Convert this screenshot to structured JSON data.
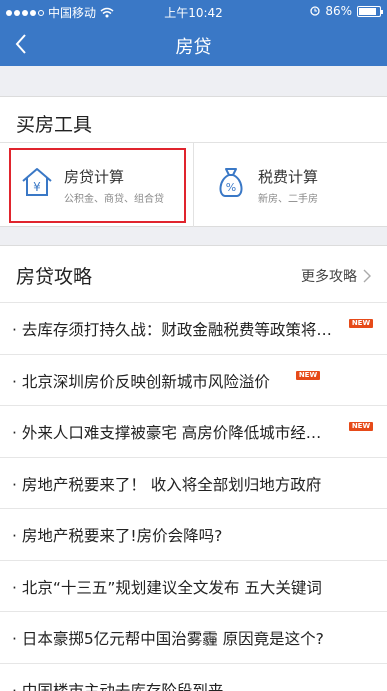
{
  "status_bar": {
    "carrier": "中国移动",
    "time": "上午10:42",
    "battery_text": "86%",
    "battery_level": 0.86,
    "icons": [
      "signal-dots",
      "wifi-icon",
      "alarm-icon",
      "battery-icon"
    ]
  },
  "nav": {
    "title": "房贷",
    "back_icon": "chevron-left-icon"
  },
  "tools": {
    "title": "买房工具",
    "items": [
      {
        "name": "房贷计算",
        "sub": "公积金、商贷、组合贷",
        "icon": "house-yen-icon",
        "highlighted": true
      },
      {
        "name": "税费计算",
        "sub": "新房、二手房",
        "icon": "money-bag-percent-icon",
        "highlighted": false
      }
    ]
  },
  "strategy": {
    "title": "房贷攻略",
    "more_label": "更多攻略",
    "badge_text": "NEW",
    "articles": [
      {
        "title": "· 去库存须打持久战：财政金融税费等政策将…",
        "is_new": true
      },
      {
        "title": "· 北京深圳房价反映创新城市风险溢价",
        "is_new": true
      },
      {
        "title": "· 外来人口难支撑被豪宅 高房价降低城市经…",
        "is_new": true
      },
      {
        "title": "· 房地产税要来了！ 收入将全部划归地方政府",
        "is_new": false
      },
      {
        "title": "· 房地产税要来了!房价会降吗?",
        "is_new": false
      },
      {
        "title": "· 北京“十三五”规划建议全文发布 五大关键词",
        "is_new": false
      },
      {
        "title": "· 日本豪掷5亿元帮中国治雾霾 原因竟是这个?",
        "is_new": false
      },
      {
        "title": "· 中国楼市主动去库存阶段到来",
        "is_new": false
      }
    ]
  },
  "colors": {
    "brand_blue": "#3a78c6",
    "highlight_red": "#e0242d",
    "badge": "#e64a19"
  }
}
